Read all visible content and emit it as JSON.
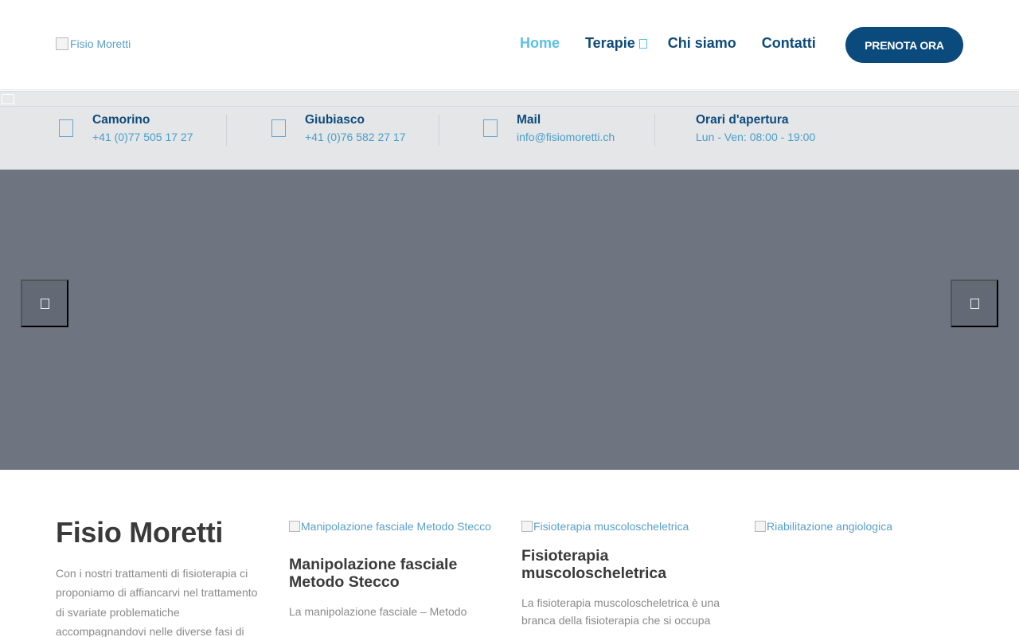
{
  "header": {
    "logo_alt": "Fisio Moretti",
    "nav": {
      "home": "Home",
      "terapie": "Terapie",
      "chi_siamo": "Chi siamo",
      "contatti": "Contatti"
    },
    "cta_label": "PRENOTA ORA"
  },
  "infobar": {
    "items": [
      {
        "title": "Camorino",
        "value": "+41 (0)77 505 17 27",
        "icon": "phone-icon"
      },
      {
        "title": "Giubiasco",
        "value": "+41 (0)76 582 27 17",
        "icon": "phone-icon"
      },
      {
        "title": "Mail",
        "value": "info@fisiomoretti.ch",
        "icon": "mail-icon"
      },
      {
        "title": "Orari d'apertura",
        "value": "Lun - Ven: 08:00 - 19:00"
      }
    ]
  },
  "intro": {
    "title": "Fisio Moretti",
    "text": "Con i nostri trattamenti di fisioterapia ci proponiamo di affiancarvi nel trattamento di svariate problematiche accompagnandovi nelle diverse fasi di"
  },
  "cards": [
    {
      "image_alt": "Manipolazione fasciale Metodo Stecco",
      "title": "Manipolazione fasciale Metodo Stecco",
      "text": "La manipolazione fasciale – Metodo"
    },
    {
      "image_alt": "Fisioterapia muscoloscheletrica",
      "title": "Fisioterapia muscoloscheletrica",
      "text": "La fisioterapia muscoloscheletrica è una branca della fisioterapia che si occupa"
    },
    {
      "image_alt": "Riabilitazione angiologica"
    }
  ],
  "colors": {
    "brand_dark": "#0a4a7d",
    "accent": "#5cc0e4",
    "slider_bg": "#6f7580",
    "infobar_bg": "#e4e6e8"
  }
}
